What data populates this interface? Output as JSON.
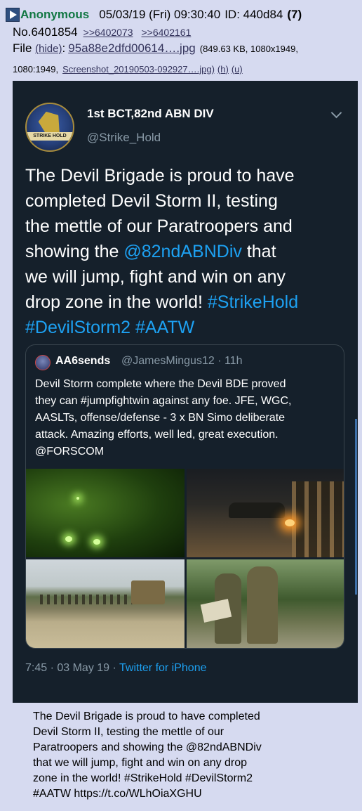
{
  "post": {
    "name": "Anonymous",
    "datetime": "05/03/19 (Fri) 09:30:40",
    "id_label": "ID: 440d84",
    "reply_count": "(7)",
    "number": "No.6401854",
    "backlinks": [
      ">>6402073",
      ">>6402161"
    ],
    "file_label": "File",
    "hide_label": "(hide)",
    "file_name": "95a88e2dfd00614….jpg",
    "file_meta": "(849.63 KB, 1080x1949,",
    "file_meta2": "1080:1949,",
    "original_name": "Screenshot_20190503-092927….jpg)",
    "h_label": "(h)",
    "u_label": "(u)"
  },
  "tweet": {
    "display_name": "1st BCT,82nd ABN DIV",
    "handle": "@Strike_Hold",
    "avatar_text": "STRIKE HOLD",
    "text_parts": {
      "t1": "The Devil Brigade is proud to have\ncompleted Devil Storm II, testing\nthe mettle of our Paratroopers and\nshowing the ",
      "mention": "@82ndABNDiv",
      "t2": " that\nwe will jump, fight and win on any\ndrop zone in the world! ",
      "tag1": "#StrikeHold",
      "t3": "\n",
      "tag2": "#DevilStorm2",
      "t4": " ",
      "tag3": "#AATW"
    },
    "timestamp": "7:45 · 03 May 19 · ",
    "source": "Twitter for iPhone"
  },
  "quote": {
    "name": "AA6sends",
    "handle": "@JamesMingus12 · 11h",
    "text": "Devil Storm complete where the Devil BDE proved\nthey can #jumpfightwin against any foe. JFE, WGC,\nAASLTs, offense/defense - 3 x BN Simo deliberate\nattack. Amazing efforts, well led, great execution.\n@FORSCOM"
  },
  "caption": "The Devil Brigade is proud to have completed\nDevil Storm II, testing the mettle of our\nParatroopers and showing the @82ndABNDiv\nthat we will jump, fight and win on any drop\nzone in the world! #StrikeHold #DevilStorm2\n#AATW https://t.co/WLhOiaXGHU",
  "colors": {
    "page_bg": "#d6daf0",
    "name_green": "#117743",
    "link": "#34345c",
    "tweet_bg": "#15202b",
    "tweet_link": "#1da1f2",
    "muted": "#8899a6"
  }
}
